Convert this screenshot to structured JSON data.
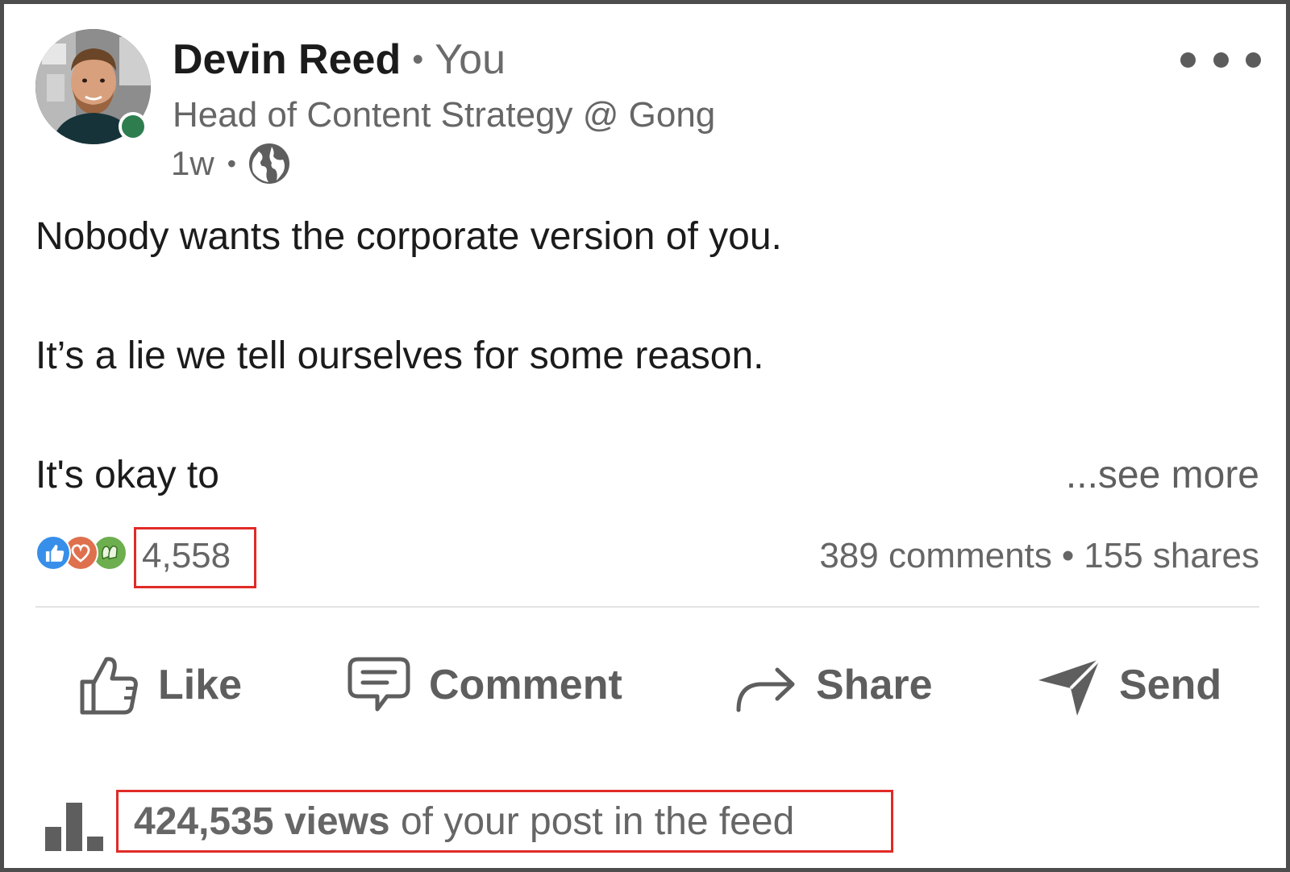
{
  "colors": {
    "online_indicator": "#2e7d4f",
    "highlight_box": "#e02b27",
    "like_reaction": "#378fe9",
    "love_reaction": "#df704d",
    "celebrate_reaction": "#6dae4f"
  },
  "author": {
    "name": "Devin Reed",
    "relation": "You",
    "headline": "Head of Content Strategy @ Gong",
    "time_ago": "1w",
    "visibility_icon": "globe-icon",
    "avatar_icon": "profile-photo",
    "online": true
  },
  "menu": {
    "icon": "ellipsis-icon"
  },
  "post": {
    "line1": "Nobody wants the corporate version of you.",
    "line2": "It’s a lie we tell ourselves for some reason.",
    "line3": "It's okay to",
    "see_more": "...see more"
  },
  "social": {
    "reaction_icons": [
      "like-reaction-icon",
      "love-reaction-icon",
      "celebrate-reaction-icon"
    ],
    "reactions_count": "4,558",
    "comments": "389 comments",
    "separator": "•",
    "shares": "155 shares"
  },
  "actions": {
    "like": {
      "label": "Like",
      "icon": "thumbs-up-icon"
    },
    "comment": {
      "label": "Comment",
      "icon": "comment-bubble-icon"
    },
    "share": {
      "label": "Share",
      "icon": "share-arrow-icon"
    },
    "send": {
      "label": "Send",
      "icon": "paper-plane-icon"
    }
  },
  "analytics": {
    "icon": "bar-chart-icon",
    "views_count": "424,535 views",
    "views_suffix": " of your post in the feed"
  }
}
